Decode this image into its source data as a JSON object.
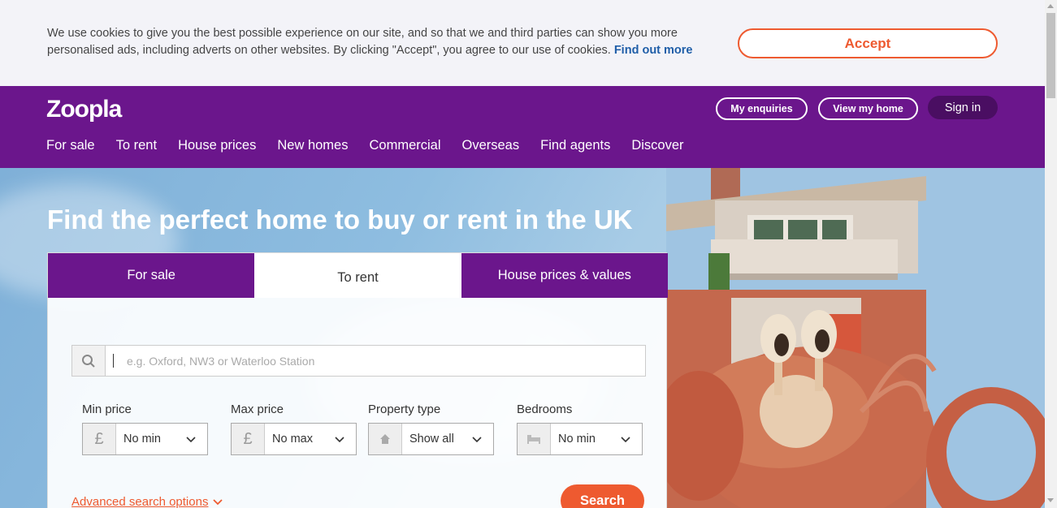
{
  "cookie_banner": {
    "text": "We use cookies to give you the best possible experience on our site, and so that we and third parties can show you more personalised ads, including adverts on other websites. By clicking \"Accept\", you agree to our use of cookies.",
    "link": "Find out more",
    "accept": "Accept"
  },
  "header": {
    "logo": "Zoopla",
    "my_enquiries": "My enquiries",
    "view_my_home": "View my home",
    "sign_in": "Sign in",
    "nav": [
      "For sale",
      "To rent",
      "House prices",
      "New homes",
      "Commercial",
      "Overseas",
      "Find agents",
      "Discover"
    ]
  },
  "hero": {
    "title": "Find the perfect home to buy or rent in the UK"
  },
  "search": {
    "tabs": [
      "For sale",
      "To rent",
      "House prices & values"
    ],
    "active_tab": "To rent",
    "placeholder": "e.g. Oxford, NW3 or Waterloo Station",
    "filters": {
      "min_price": {
        "label": "Min price",
        "value": "No min",
        "prefix": "£"
      },
      "max_price": {
        "label": "Max price",
        "value": "No max",
        "prefix": "£"
      },
      "property_type": {
        "label": "Property type",
        "value": "Show all",
        "icon": "house-icon"
      },
      "bedrooms": {
        "label": "Bedrooms",
        "value": "No min",
        "icon": "bed-icon"
      }
    },
    "advanced": "Advanced search options",
    "submit": "Search"
  },
  "colors": {
    "brand_purple": "#6b168c",
    "accent_orange": "#ee5a30",
    "link_blue": "#1f5ea8"
  }
}
